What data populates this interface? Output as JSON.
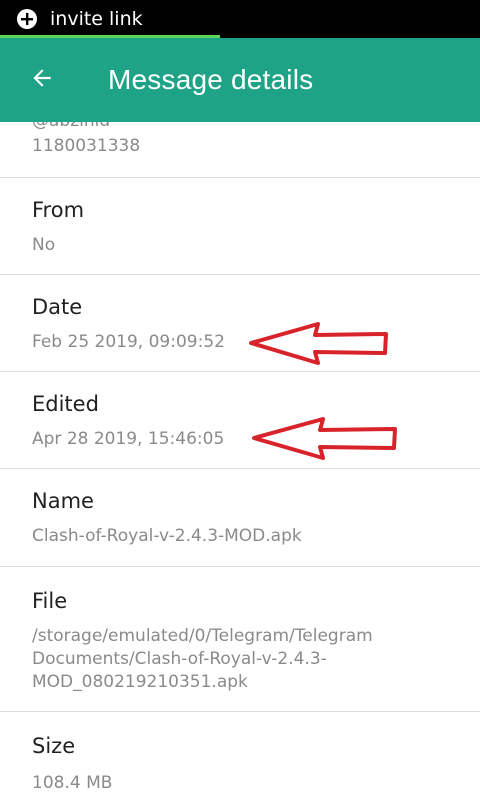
{
  "status_bar": {
    "notification_icon": "plus-circle-icon",
    "notification_text": "invite link",
    "progress_fraction": 0.46
  },
  "app_bar": {
    "back_icon": "arrow-back-icon",
    "title": "Message details",
    "color": "#1ea386"
  },
  "partial_item": {
    "username": "@abzinid",
    "id": "1180031338"
  },
  "details": [
    {
      "label": "From",
      "value": "No"
    },
    {
      "label": "Date",
      "value": "Feb 25 2019, 09:09:52"
    },
    {
      "label": "Edited",
      "value": "Apr 28 2019, 15:46:05"
    },
    {
      "label": "Name",
      "value": "Clash-of-Royal-v-2.4.3-MOD.apk"
    },
    {
      "label": "File",
      "value": "/storage/emulated/0/Telegram/Telegram Documents/Clash-of-Royal-v-2.4.3-MOD_080219210351.apk"
    },
    {
      "label": "Size",
      "value": "108.4 MB"
    }
  ],
  "annotations": {
    "arrow_color": "#d9232a",
    "arrow_icon": "left-arrow-outline-icon"
  }
}
